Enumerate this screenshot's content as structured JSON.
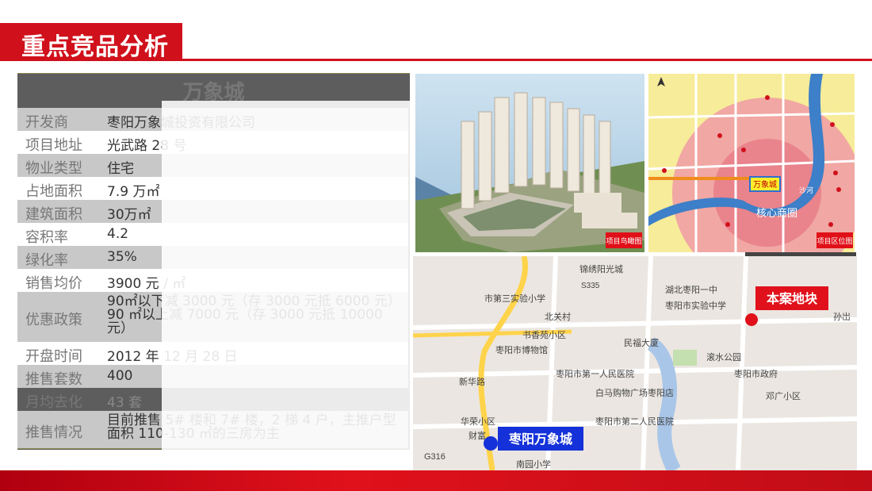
{
  "header": {
    "title": "重点竞品分析"
  },
  "project": {
    "name": "万象城",
    "rows": [
      {
        "label": "开发商",
        "value": "枣阳万象城投资有限公司"
      },
      {
        "label": "项目地址",
        "value": "光武路 28 号"
      },
      {
        "label": "物业类型",
        "value": "住宅"
      },
      {
        "label": "占地面积",
        "value": "7.9 万㎡"
      },
      {
        "label": "建筑面积",
        "value": "30万㎡"
      },
      {
        "label": "容积率",
        "value": "4.2"
      },
      {
        "label": "绿化率",
        "value": "35%"
      },
      {
        "label": "销售均价",
        "value": "3900 元 / ㎡"
      },
      {
        "label": "优惠政策",
        "value": "90㎡以下减 3000 元（存 3000 元抵 6000 元）90 ㎡以上减 7000 元（存 3000 元抵 10000元）"
      },
      {
        "label": "开盘时间",
        "value": "2012 年 12 月 28 日"
      },
      {
        "label": "推售套数",
        "value": "400"
      },
      {
        "label": "月均去化",
        "value": "43 套"
      },
      {
        "label": "推售情况",
        "value": "目前推售 5# 楼和 7# 楼，2 梯 4 户，主推户型面积 110-130 ㎡的三房为主"
      }
    ]
  },
  "photo": {
    "tag": "项目鸟瞰图"
  },
  "minimap": {
    "tag": "项目区位图",
    "label_project": "万象城",
    "label_zone": "核心商圈",
    "label_river": "沙河"
  },
  "bigmap": {
    "road_labels": [
      "锦绣阳光城",
      "S335",
      "湖北枣阳一中",
      "市第三实验小学",
      "枣阳市实验中学",
      "北关村",
      "书香苑小区",
      "民福大厦",
      "枣阳市博物馆",
      "滚水公园",
      "枣阳市第一人民医院",
      "枣阳市政府",
      "白马购物广场枣阳店",
      "邓广小区",
      "华荣小区",
      "枣阳市第二人民医院",
      "南园小学",
      "G316",
      "新华路",
      "财富",
      "孙岀"
    ],
    "marker_site": "本案地块",
    "marker_competitor": "枣阳万象城"
  },
  "colors": {
    "brand_red": "#d0101b",
    "marker_blue": "#1531d9"
  }
}
